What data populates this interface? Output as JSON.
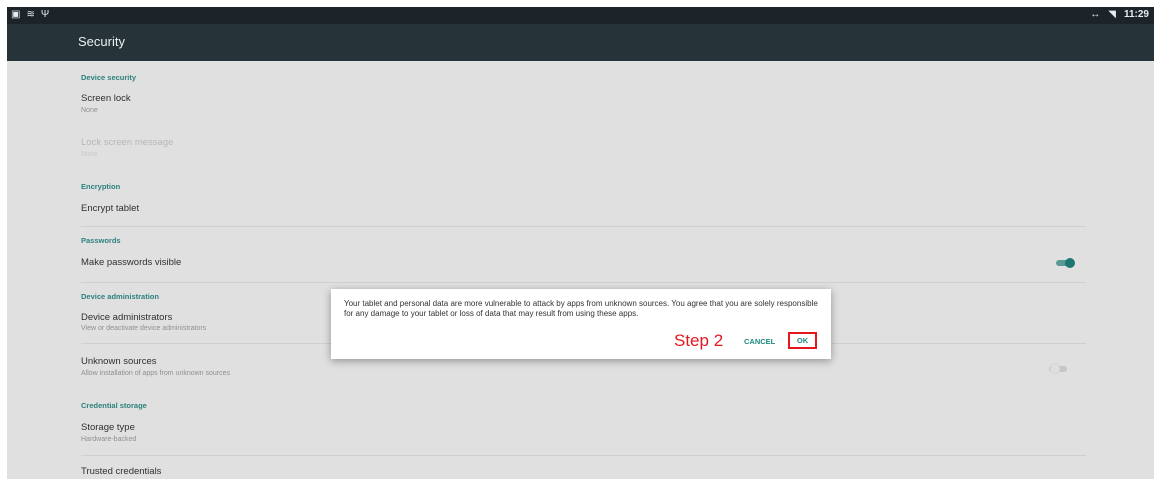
{
  "status_bar": {
    "left_icons": [
      "photo-icon",
      "wifi-icon",
      "usb-icon"
    ],
    "right_icons": [
      "data-transfer-icon",
      "signal-icon"
    ],
    "time": "11:29"
  },
  "toolbar": {
    "title": "Security"
  },
  "sections": {
    "device_security": {
      "header": "Device security",
      "screen_lock": {
        "title": "Screen lock",
        "summary": "None"
      },
      "lock_screen_message": {
        "title": "Lock screen message",
        "summary": "None"
      }
    },
    "encryption": {
      "header": "Encryption",
      "encrypt_tablet": {
        "title": "Encrypt tablet"
      }
    },
    "passwords": {
      "header": "Passwords",
      "make_passwords_visible": {
        "title": "Make passwords visible",
        "checked": true
      }
    },
    "device_administration": {
      "header": "Device administration",
      "device_administrators": {
        "title": "Device administrators",
        "summary": "View or deactivate device administrators"
      },
      "unknown_sources": {
        "title": "Unknown sources",
        "summary": "Allow installation of apps from unknown sources",
        "checked": false
      }
    },
    "credential_storage": {
      "header": "Credential storage",
      "storage_type": {
        "title": "Storage type",
        "summary": "Hardware-backed"
      },
      "trusted_credentials": {
        "title": "Trusted credentials"
      }
    }
  },
  "dialog": {
    "message": "Your tablet and personal data are more vulnerable to attack by apps from unknown sources. You agree that you are solely responsible for any damage to your tablet or loss of data that may result from using these apps.",
    "annotation": "Step 2",
    "cancel_label": "CANCEL",
    "ok_label": "OK"
  },
  "colors": {
    "accent": "#1d8a80",
    "toolbar": "#26343a",
    "status_bar": "#1c2429",
    "annotation_red": "#e5171e"
  }
}
